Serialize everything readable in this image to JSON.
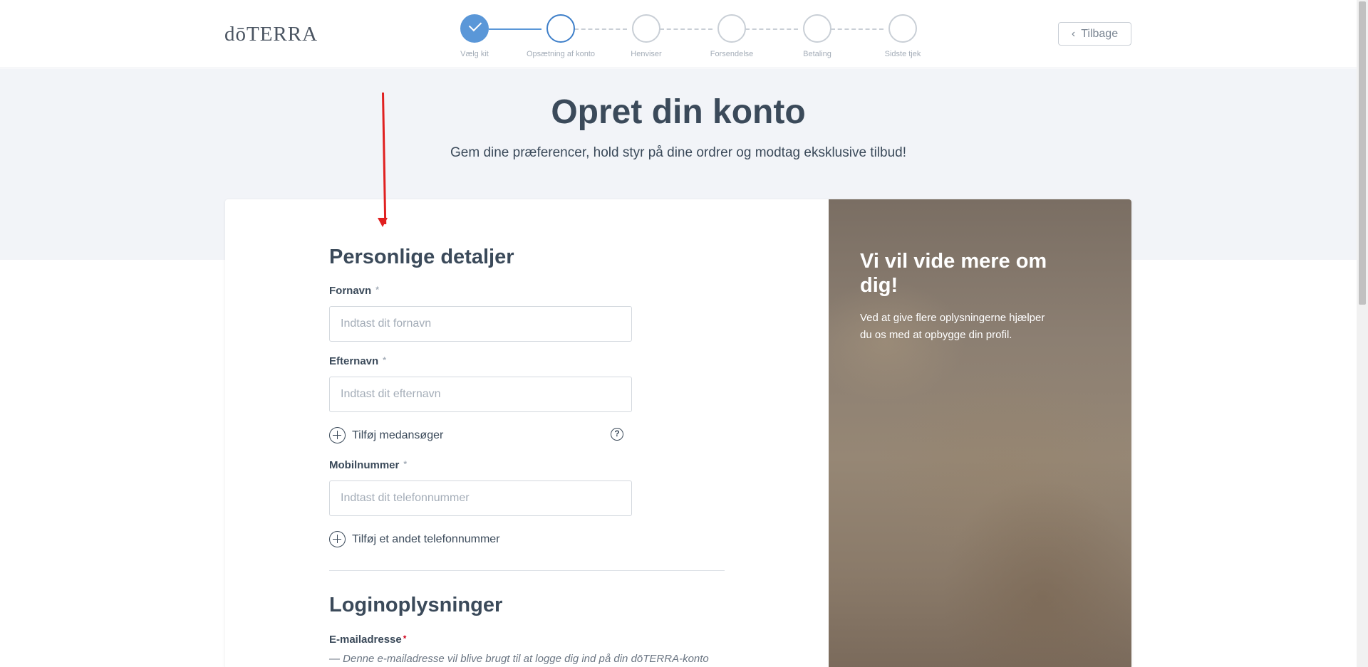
{
  "header": {
    "logo": "dōTERRA",
    "back_label": "Tilbage",
    "steps": [
      {
        "label": "Vælg kit",
        "state": "done"
      },
      {
        "label": "Opsætning af konto",
        "state": "active"
      },
      {
        "label": "Henviser",
        "state": "pending"
      },
      {
        "label": "Forsendelse",
        "state": "pending"
      },
      {
        "label": "Betaling",
        "state": "pending"
      },
      {
        "label": "Sidste tjek",
        "state": "pending"
      }
    ]
  },
  "hero": {
    "title": "Opret din konto",
    "subtitle": "Gem dine præferencer, hold styr på dine ordrer og modtag eksklusive tilbud!"
  },
  "form": {
    "section_personal": "Personlige detaljer",
    "first_name_label": "Fornavn",
    "first_name_placeholder": "Indtast dit fornavn",
    "last_name_label": "Efternavn",
    "last_name_placeholder": "Indtast dit efternavn",
    "add_coapplicant": "Tilføj medansøger",
    "mobile_label": "Mobilnummer",
    "mobile_placeholder": "Indtast dit telefonnummer",
    "add_phone": "Tilføj et andet telefonnummer",
    "section_login": "Loginoplysninger",
    "email_label": "E-mailadresse",
    "email_note": "— Denne e-mailadresse vil blive brugt til at logge dig ind på din dōTERRA-konto",
    "required_mark": "*",
    "help_glyph": "?"
  },
  "side_panel": {
    "title": "Vi vil vide mere om dig!",
    "text": "Ved at give flere oplysningerne hjælper du os med at opbygge din profil."
  },
  "colors": {
    "accent": "#5a97d8",
    "text": "#3b4a5a",
    "annotation": "#e02020",
    "hero_bg": "#f2f4f8"
  }
}
